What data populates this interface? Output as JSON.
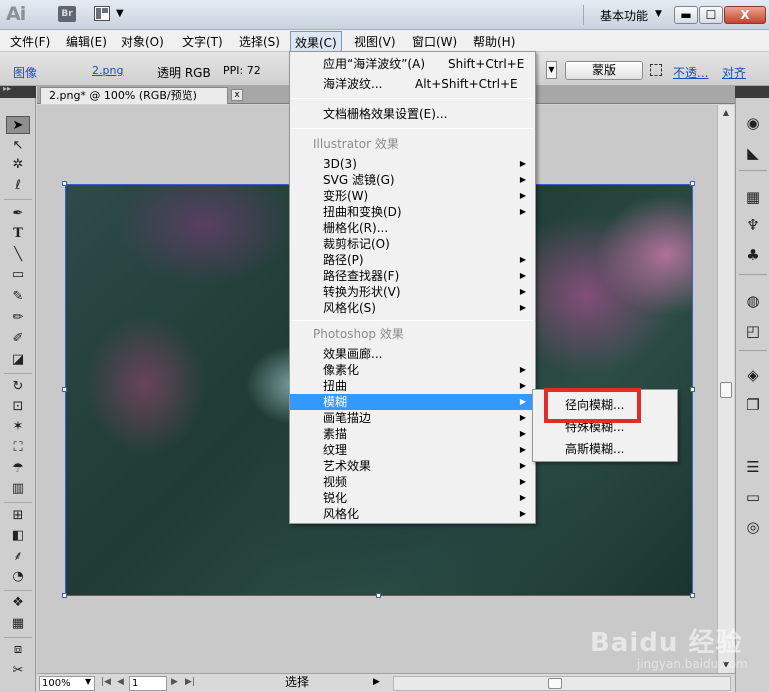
{
  "titlebar": {
    "app_logo": "Ai",
    "bridge_label": "Br",
    "workspace": "基本功能",
    "minimize": "▬",
    "maximize": "☐",
    "close": "X"
  },
  "menubar": {
    "items": [
      "文件(F)",
      "编辑(E)",
      "对象(O)",
      "文字(T)",
      "选择(S)",
      "效果(C)",
      "视图(V)",
      "窗口(W)",
      "帮助(H)"
    ]
  },
  "controlbar": {
    "image_label": "图像",
    "file_name": "2.png",
    "color_mode": "透明 RGB",
    "ppi": "PPI: 72",
    "mask_button": "蒙版",
    "opacity_link": "不透...",
    "align_link": "对齐"
  },
  "document": {
    "tab_title": "2.png* @ 100% (RGB/预览)",
    "tab_close": "x"
  },
  "effect_menu": {
    "apply_last_label": "应用“海洋波纹”(A)",
    "apply_last_key": "Shift+Ctrl+E",
    "last_effect_label": "海洋波纹...",
    "last_effect_key": "Alt+Shift+Ctrl+E",
    "doc_raster_settings": "文档栅格效果设置(E)...",
    "illustrator_header": "Illustrator 效果",
    "illustrator_items": [
      "3D(3)",
      "SVG 滤镜(G)",
      "变形(W)",
      "扭曲和变换(D)",
      "栅格化(R)...",
      "裁剪标记(O)",
      "路径(P)",
      "路径查找器(F)",
      "转换为形状(V)",
      "风格化(S)"
    ],
    "photoshop_header": "Photoshop 效果",
    "photoshop_items": [
      "效果画廊...",
      "像素化",
      "扭曲",
      "模糊",
      "画笔描边",
      "素描",
      "纹理",
      "艺术效果",
      "视频",
      "锐化",
      "风格化"
    ]
  },
  "blur_submenu": {
    "items": [
      "径向模糊...",
      "特殊模糊...",
      "高斯模糊..."
    ]
  },
  "statusbar": {
    "zoom": "100%",
    "page": "1",
    "current_tool": "选择"
  },
  "watermark": {
    "brand": "Baidu 经验",
    "url": "jingyan.baidu.com"
  },
  "colors": {
    "menu_highlight": "#3399ff",
    "annotation_red": "#e22b2b",
    "link_blue": "#1a4fb0"
  }
}
